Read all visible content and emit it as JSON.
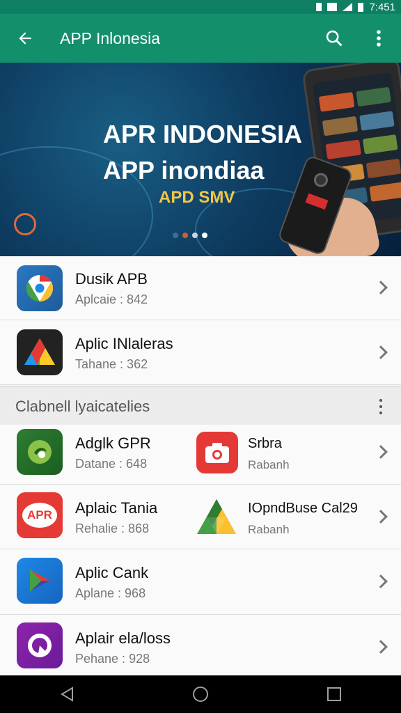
{
  "status_bar": {
    "time": "7:451"
  },
  "app_bar": {
    "title": "APP Inlonesia",
    "icons": [
      "arrow-back-icon",
      "search-icon",
      "more-vert-icon"
    ]
  },
  "banner": {
    "line1": "APR INDONESIA",
    "line2": "APP inondiaa",
    "line3": "APD SMV",
    "carousel_pages": 4,
    "carousel_active": 3
  },
  "top_list": [
    {
      "name": "Dusik APB",
      "sub": "Aplcaie : 842",
      "icon": "chrome-like-icon"
    },
    {
      "name": "Aplic INlaleras",
      "sub": "Tahane : 362",
      "icon": "drive-like-icon"
    }
  ],
  "section": {
    "title": "Clabnell lyaicatelies"
  },
  "grid_rows": [
    {
      "left": {
        "name": "Adglk GPR",
        "sub": "Datane : 648",
        "icon": "green-app-icon"
      },
      "right": {
        "name": "Srbra",
        "sub": "Rabanh",
        "icon": "camera-app-icon"
      }
    },
    {
      "left": {
        "name": "Aplaic Tania",
        "sub": "Rehalie : 868",
        "icon": "apr-app-icon",
        "icon_text": "APR"
      },
      "right": {
        "name": "IOpndBuse Cal29",
        "sub": "Rabanh",
        "icon": "drive-triangle-icon"
      }
    }
  ],
  "bottom_list": [
    {
      "name": "Aplic Cank",
      "sub": "Aplane : 968",
      "icon": "play-store-like-icon"
    },
    {
      "name": "Aplair ela/loss",
      "sub": "Pehane : 928",
      "icon": "purple-app-icon"
    }
  ],
  "nav_bar": {
    "icons": [
      "back-triangle-icon",
      "home-circle-icon",
      "recents-square-icon"
    ]
  },
  "colors": {
    "app_bar": "#148f6c",
    "status_bar": "#0f7f63",
    "banner_title": "#ffffff",
    "banner_accent": "#f3c64a"
  }
}
